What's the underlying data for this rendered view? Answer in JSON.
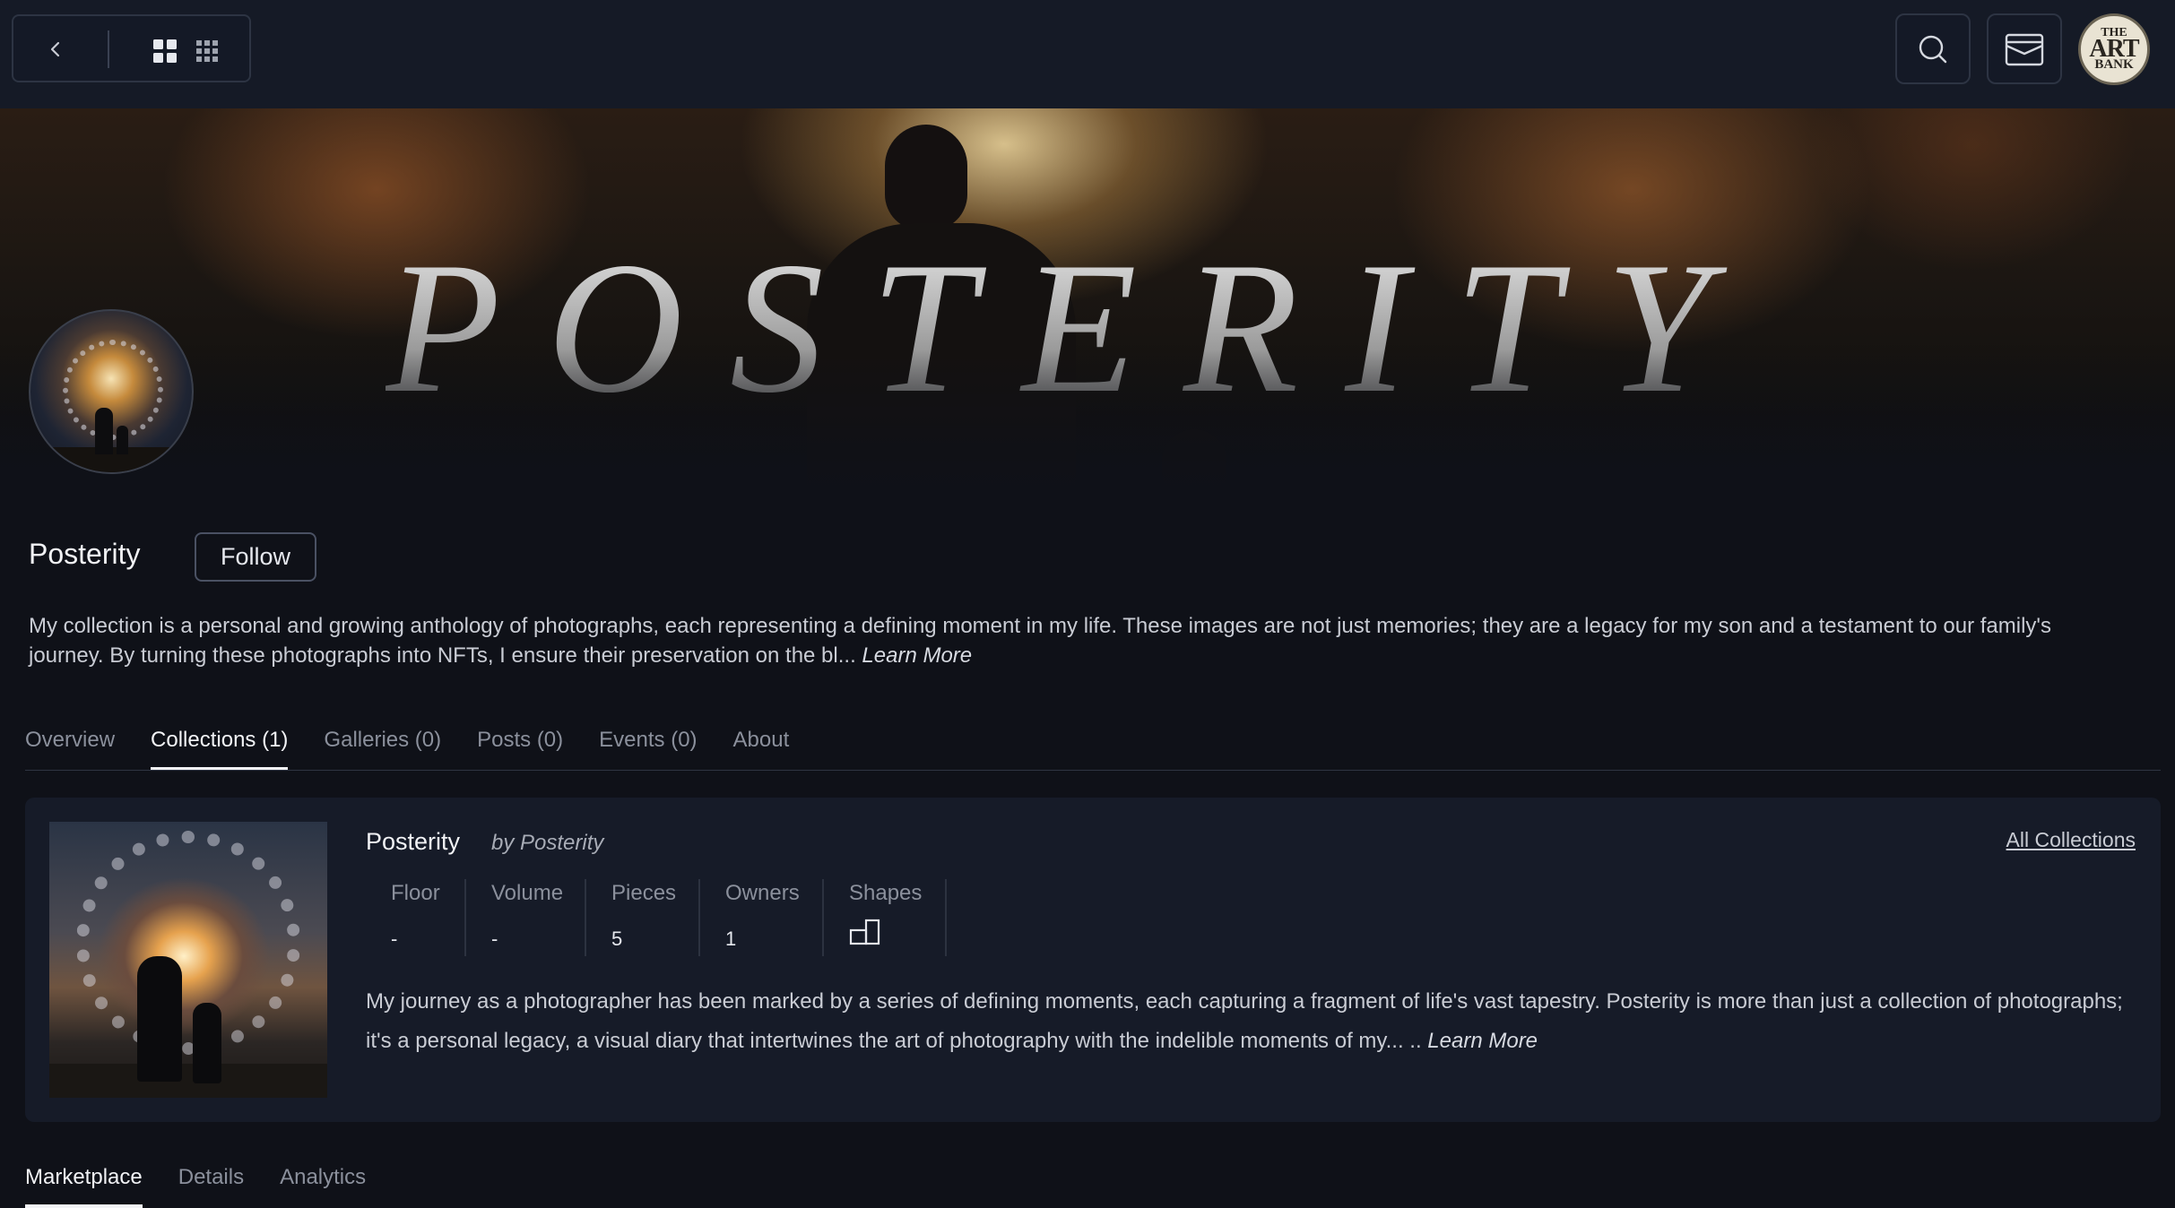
{
  "topbar": {
    "back_icon": "chevron-left-icon",
    "grid_large_icon": "grid-large-icon",
    "grid_small_icon": "grid-small-icon",
    "search_icon": "search-icon",
    "wallet_icon": "wallet-icon",
    "logo": {
      "line1": "THE",
      "line2": "ART",
      "line3": "BANK"
    }
  },
  "banner": {
    "title": "POSTERITY"
  },
  "profile": {
    "name": "Posterity",
    "follow_label": "Follow",
    "description": "My collection is a personal and growing anthology of photographs, each representing a defining moment in my life. These images are not just memories; they are a legacy for my son and a testament to our family's journey. By turning these photographs into NFTs, I ensure their preservation on the bl...",
    "learn_more": "Learn More"
  },
  "tabs": [
    {
      "label": "Overview",
      "active": false
    },
    {
      "label": "Collections (1)",
      "active": true
    },
    {
      "label": "Galleries (0)",
      "active": false
    },
    {
      "label": "Posts (0)",
      "active": false
    },
    {
      "label": "Events (0)",
      "active": false
    },
    {
      "label": "About",
      "active": false
    }
  ],
  "collection": {
    "title": "Posterity",
    "by": "by Posterity",
    "all_collections": "All Collections",
    "stats": {
      "floor": {
        "label": "Floor",
        "value": "-"
      },
      "volume": {
        "label": "Volume",
        "value": "-"
      },
      "pieces": {
        "label": "Pieces",
        "value": "5"
      },
      "owners": {
        "label": "Owners",
        "value": "1"
      },
      "shapes": {
        "label": "Shapes",
        "icon": "shapes-icon"
      }
    },
    "description": "My journey as a photographer has been marked by a series of defining moments, each capturing a fragment of life's vast tapestry. Posterity is more than just a collection of photographs; it's a personal legacy, a visual diary that intertwines the art of photography with the indelible moments of my... ..",
    "learn_more": "Learn More"
  },
  "bottom_tabs": [
    {
      "label": "Marketplace",
      "active": true
    },
    {
      "label": "Details",
      "active": false
    },
    {
      "label": "Analytics",
      "active": false
    }
  ],
  "colors": {
    "background": "#0f1118",
    "topbar": "#151a26",
    "card": "#161b28",
    "active_tab": "#f2f3f6",
    "inactive_tab": "#8b909c"
  }
}
